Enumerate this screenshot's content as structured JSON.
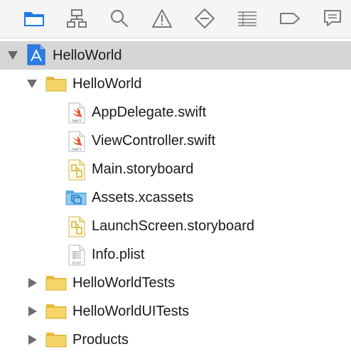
{
  "navigator": {
    "selected_tab": "project",
    "tabs": [
      {
        "id": "project",
        "icon": "folder-icon"
      },
      {
        "id": "symbol",
        "icon": "hierarchy-icon"
      },
      {
        "id": "find",
        "icon": "search-icon"
      },
      {
        "id": "issue",
        "icon": "warning-icon"
      },
      {
        "id": "test",
        "icon": "diamond-minus-icon"
      },
      {
        "id": "debug",
        "icon": "list-icon"
      },
      {
        "id": "breakpoint",
        "icon": "tag-icon"
      },
      {
        "id": "report",
        "icon": "speech-bubble-icon"
      }
    ],
    "accent_color": "#1b7ae6"
  },
  "tree": {
    "project": {
      "label": "HelloWorld",
      "expanded": true,
      "icon": "xcode-project-icon"
    },
    "groups": [
      {
        "label": "HelloWorld",
        "expanded": true,
        "icon": "folder-icon",
        "files": [
          {
            "label": "AppDelegate.swift",
            "icon": "swift-file-icon",
            "badge": "SWIFT"
          },
          {
            "label": "ViewController.swift",
            "icon": "swift-file-icon",
            "badge": "SWIFT"
          },
          {
            "label": "Main.storyboard",
            "icon": "storyboard-file-icon"
          },
          {
            "label": "Assets.xcassets",
            "icon": "asset-catalog-icon"
          },
          {
            "label": "LaunchScreen.storyboard",
            "icon": "storyboard-file-icon"
          },
          {
            "label": "Info.plist",
            "icon": "plist-file-icon",
            "badge": "PLIST"
          }
        ]
      },
      {
        "label": "HelloWorldTests",
        "expanded": false,
        "icon": "folder-icon"
      },
      {
        "label": "HelloWorldUITests",
        "expanded": false,
        "icon": "folder-icon"
      },
      {
        "label": "Products",
        "expanded": false,
        "icon": "folder-icon"
      }
    ]
  }
}
